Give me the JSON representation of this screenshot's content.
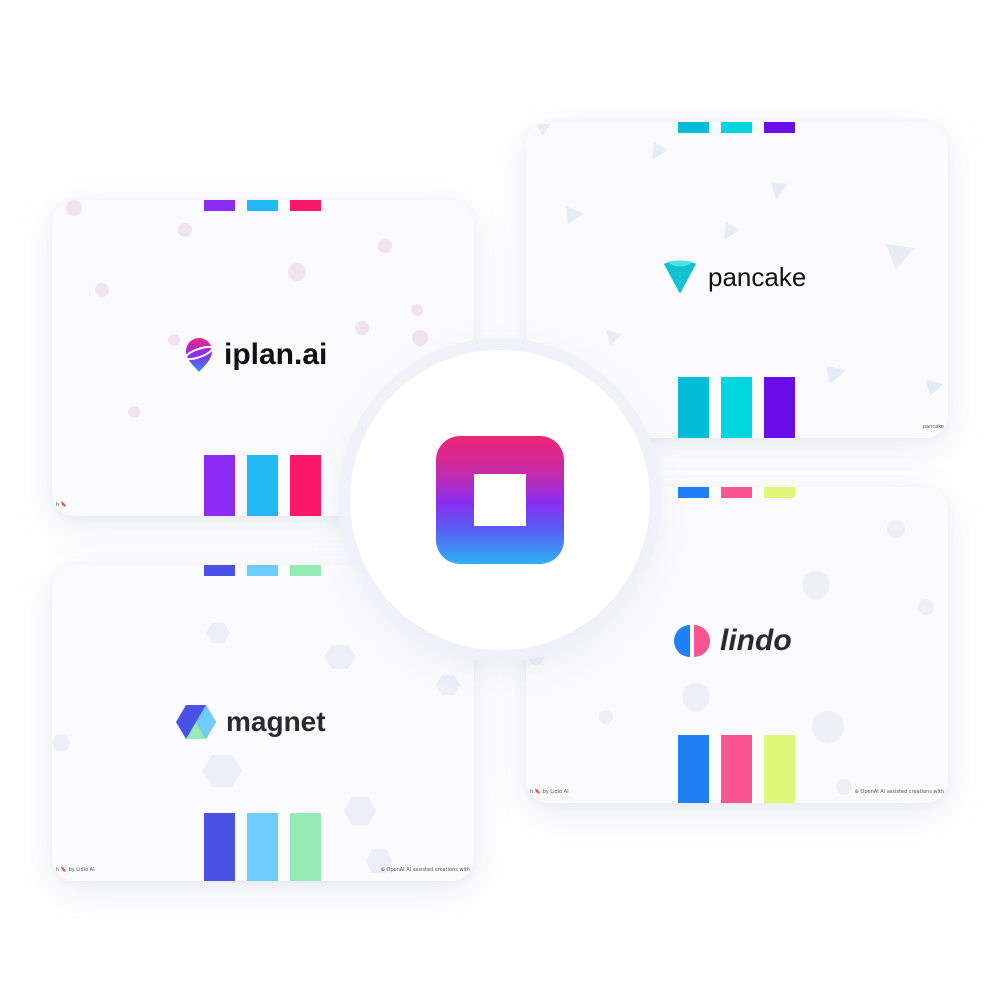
{
  "cards": {
    "iplan": {
      "brand": "iplan.ai",
      "footer_left": "h 🔖",
      "top_swatches": [
        "#8a2cf4",
        "#22b8f5",
        "#fc1869"
      ],
      "bottom_swatches": [
        "#8a2cf4",
        "#22b8f5",
        "#fc1869"
      ]
    },
    "pancake": {
      "brand": "pancake",
      "footer_right": "pancake",
      "top_swatches": [
        "#00bcd4",
        "#00d6e0",
        "#6b0de8"
      ],
      "bottom_swatches": [
        "#00bcd4",
        "#00d6e0",
        "#6b0de8"
      ]
    },
    "magnet": {
      "brand": "magnet",
      "footer_left": "h 🔖 by Lidio AI",
      "footer_right": "⊛ OpenAI  AI assisted creations with",
      "top_swatches": [
        "#4a52e6",
        "#6ecbfa",
        "#93eab4"
      ],
      "bottom_swatches": [
        "#4a52e6",
        "#6ecbfa",
        "#93eab4"
      ]
    },
    "lindo": {
      "brand": "lindo",
      "footer_left": "h 🔖 by Lidio AI",
      "footer_right": "⊛ OpenAI  AI assisted creations with",
      "top_swatches": [
        "#1f7ff5",
        "#fb5590",
        "#e0f77a"
      ],
      "bottom_swatches": [
        "#1f7ff5",
        "#fb5590",
        "#e0f77a"
      ]
    }
  },
  "icons": {
    "app": "app-square-icon",
    "iplan": "planet-pin-icon",
    "pancake": "chevron-v-icon",
    "magnet": "hexagon-icon",
    "lindo": "split-circle-icon"
  },
  "colors": {
    "text": "#111111",
    "gradient_top": "#ee2676",
    "gradient_mid": "#8b2df0",
    "gradient_bottom": "#2fb0f6"
  }
}
